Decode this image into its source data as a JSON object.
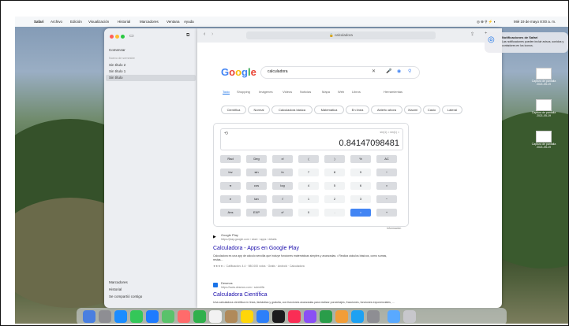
{
  "menubar": {
    "apple_icon": "apple-icon",
    "items": [
      "Safari",
      "Archivo",
      "Edición",
      "Visualización",
      "Historial",
      "Marcadores",
      "Ventana",
      "Ayuda"
    ],
    "clock": "Mié 19 de mayo 8:00 a. m."
  },
  "finder": {
    "items": [
      "Comenzar",
      "Nuevo de semestre",
      "Sin título 2",
      "Sin título 1",
      "Sin título"
    ],
    "bottom_items": [
      "Marcadores",
      "Historial",
      "Se compartió contigo"
    ]
  },
  "browser": {
    "url": "calculadora",
    "google_logo": "Google",
    "search_query": "calculadora",
    "tabs": [
      "Todo",
      "Shopping",
      "Imágenes",
      "Videos",
      "Noticias",
      "Mapa",
      "Web",
      "Libros",
      "Herramientas"
    ],
    "pills": [
      "Científica",
      "Normal",
      "Calculadora básica",
      "Matemática",
      "En línea",
      "Abierto ahora",
      "Xiaomi",
      "Casio",
      "Lateral"
    ],
    "calculator": {
      "history": "sin(1) = sin(1) =",
      "result": "0.84147098481",
      "keys": [
        [
          "Rad",
          "Deg",
          "x!",
          "(",
          ")",
          "%",
          "AC"
        ],
        [
          "Inv",
          "sin",
          "ln",
          "7",
          "8",
          "9",
          "÷"
        ],
        [
          "π",
          "cos",
          "log",
          "4",
          "5",
          "6",
          "×"
        ],
        [
          "e",
          "tan",
          "√",
          "1",
          "2",
          "3",
          "−"
        ],
        [
          "Ans",
          "EXP",
          "xʸ",
          "0",
          ".",
          "=",
          "+"
        ]
      ],
      "more_info": "Información"
    },
    "results": [
      {
        "source": "Google Play",
        "url": "https://play.google.com › store › apps › details",
        "title": "Calculadora - Apps en Google Play",
        "snippet": "Calculadora es una app de cálculo sencilla que incluye funciones matemáticas simples y avanzadas. • Realiza cálculos básicos, como sumas, restas...",
        "rating": "★★★★☆ Calificación: 4.4 · 980.000 votos · Gratis · Android · Calculadora"
      },
      {
        "source": "Desmos",
        "url": "https://www.desmos.com › scientific",
        "title": "Calculadora Científica",
        "snippet": "Una calculadora científica en línea, fantástica y gratuita, con funciones avanzadas para realizar porcentajes, fracciones, funciones exponenciales, ..."
      }
    ]
  },
  "notification": {
    "title": "Notificaciones de Safari",
    "body": "Las notificaciones pueden incluir avisos, sonidos y contadores en los iconos."
  },
  "desktop_files": [
    "Captura de pantalla 2021-05-19",
    "Captura de pantalla 2021-05-19",
    "Captura de pantalla 2021-05-19"
  ],
  "colors": {
    "google_blue": "#4285f4",
    "link": "#1a0dab",
    "accent": "#1a73e8"
  }
}
